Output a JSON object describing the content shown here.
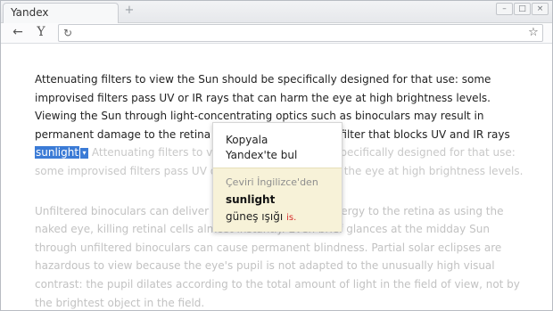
{
  "window": {
    "tab_title": "Yandex",
    "new_tab_glyph": "+"
  },
  "controls": {
    "minimize": "–",
    "maximize": "□",
    "close": "×"
  },
  "toolbar": {
    "back_glyph": "←",
    "yandex_glyph": "Y",
    "reload_glyph": "↻",
    "star_glyph": "☆",
    "address_value": ""
  },
  "article": {
    "p1_before": "Attenuating filters to view the Sun should be specifically designed for that use: some improvised filters pass UV or IR rays that can harm the eye at high brightness levels. Viewing the Sun through light-concentrating optics such as binoculars may result in permanent damage to the retina without an appropriate filter that blocks UV and IR rays ",
    "p1_selected": "sunlight",
    "p1_after": " Attenuating filters to view the Sun should be specifically designed for that use: some improvised filters pass UV or IR rays that can harm the eye at high brightness levels.",
    "p2": "Unfiltered binoculars can deliver over 500 times more energy to the retina as using the naked eye, killing retinal cells almost instantly. Even brief glances at the midday Sun through unfiltered binoculars can cause permanent blindness. Partial solar eclipses are hazardous to view because the eye's pupil is not adapted to the unusually high visual contrast: the pupil dilates according to the total amount of light in the field of view, not by the brightest object in the field."
  },
  "popup": {
    "copy_label": "Kopyala",
    "search_label": "Yandex'te bul",
    "translate_header": "Çeviri İngilizce'den",
    "word": "sunlight",
    "meaning": "güneş ışığı",
    "part_of_speech": "is."
  },
  "icons": {
    "selection_arrow": "▾"
  }
}
